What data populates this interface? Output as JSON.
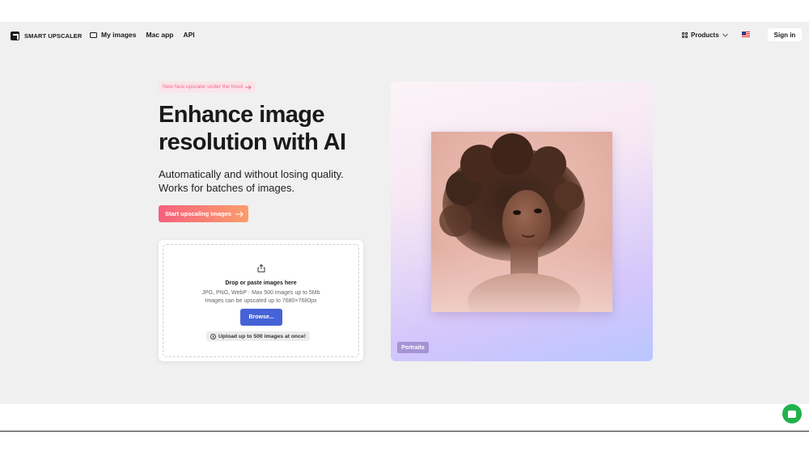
{
  "nav": {
    "brand": "SMART UPSCALER",
    "links": [
      "My images",
      "Mac app",
      "API"
    ],
    "products_label": "Products",
    "signin_label": "Sign in"
  },
  "hero": {
    "pill_label": "New face upscaler under the hood",
    "headline_line1": "Enhance image",
    "headline_line2": "resolution with AI",
    "sub_line1": "Automatically and without losing quality.",
    "sub_line2": "Works for batches of images.",
    "cta_label": "Start upscaling images"
  },
  "upload": {
    "title": "Drop or paste images here",
    "line1": "JPG, PNG, WebP · Max 500 images up to 5Mb",
    "line2": "Images can be upscaled up to 7680×7680px",
    "browse_label": "Browse...",
    "limit_label": "Upload up to 500 images at once!"
  },
  "visual": {
    "tag_label": "Portraits"
  },
  "colors": {
    "accent_start": "#f6607d",
    "accent_end": "#fb9e6b",
    "browse": "#4563d6",
    "chat": "#22b14c"
  },
  "icons": [
    "logo-icon",
    "image-icon",
    "grid-icon",
    "chevron-down-icon",
    "arrow-right-icon",
    "share-icon",
    "info-icon",
    "chat-icon",
    "us-flag-icon"
  ]
}
